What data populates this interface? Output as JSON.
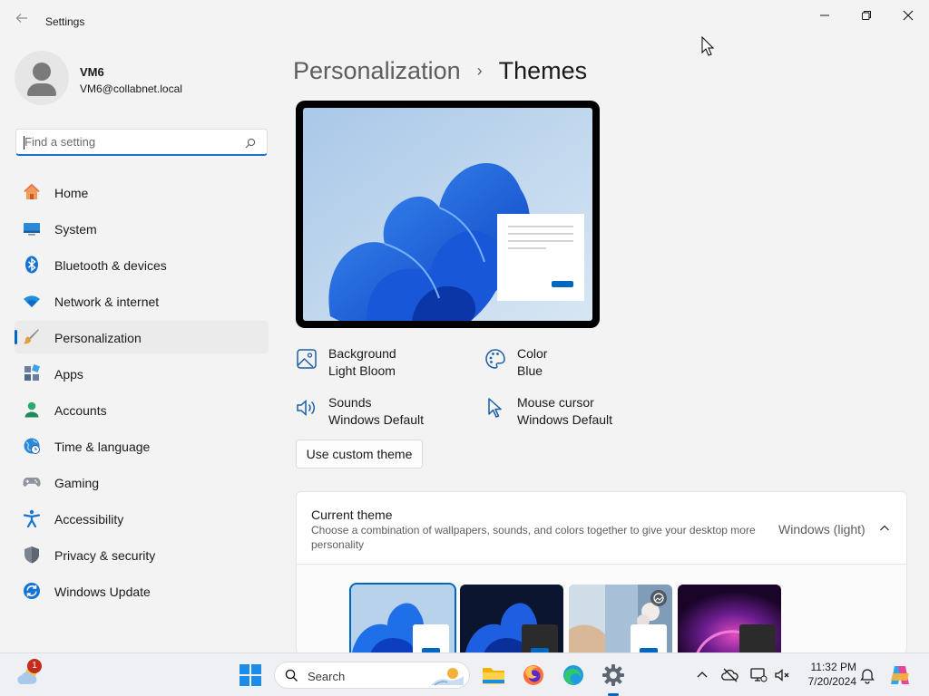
{
  "window": {
    "title": "Settings"
  },
  "user": {
    "name": "VM6",
    "email": "VM6@collabnet.local"
  },
  "search": {
    "placeholder": "Find a setting"
  },
  "sidebar": {
    "items": [
      {
        "label": "Home",
        "icon": "home-icon",
        "active": false
      },
      {
        "label": "System",
        "icon": "system-icon",
        "active": false
      },
      {
        "label": "Bluetooth & devices",
        "icon": "bluetooth-icon",
        "active": false
      },
      {
        "label": "Network & internet",
        "icon": "wifi-icon",
        "active": false
      },
      {
        "label": "Personalization",
        "icon": "paintbrush-icon",
        "active": true
      },
      {
        "label": "Apps",
        "icon": "apps-icon",
        "active": false
      },
      {
        "label": "Accounts",
        "icon": "accounts-icon",
        "active": false
      },
      {
        "label": "Time & language",
        "icon": "time-language-icon",
        "active": false
      },
      {
        "label": "Gaming",
        "icon": "gamepad-icon",
        "active": false
      },
      {
        "label": "Accessibility",
        "icon": "accessibility-icon",
        "active": false
      },
      {
        "label": "Privacy & security",
        "icon": "shield-icon",
        "active": false
      },
      {
        "label": "Windows Update",
        "icon": "windows-update-icon",
        "active": false
      }
    ]
  },
  "header": {
    "parent": "Personalization",
    "separator": "›",
    "current": "Themes"
  },
  "theme_properties": {
    "background": {
      "title": "Background",
      "value": "Light Bloom"
    },
    "color": {
      "title": "Color",
      "value": "Blue"
    },
    "sounds": {
      "title": "Sounds",
      "value": "Windows Default"
    },
    "mouse_cursor": {
      "title": "Mouse cursor",
      "value": "Windows Default"
    }
  },
  "custom_theme_button": "Use custom theme",
  "current_theme": {
    "title": "Current theme",
    "description": "Choose a combination of wallpapers, sounds, and colors together to give your desktop more personality",
    "value": "Windows (light)",
    "thumbnails": [
      {
        "name": "windows-light",
        "selected": true
      },
      {
        "name": "windows-dark",
        "selected": false
      },
      {
        "name": "spotlight",
        "selected": false
      },
      {
        "name": "glow",
        "selected": false
      }
    ]
  },
  "taskbar": {
    "weather_badge": "1",
    "search_label": "Search",
    "time": "11:32 PM",
    "date": "7/20/2024"
  },
  "colors": {
    "accent": "#0067c0",
    "background": "#f3f3f3"
  }
}
